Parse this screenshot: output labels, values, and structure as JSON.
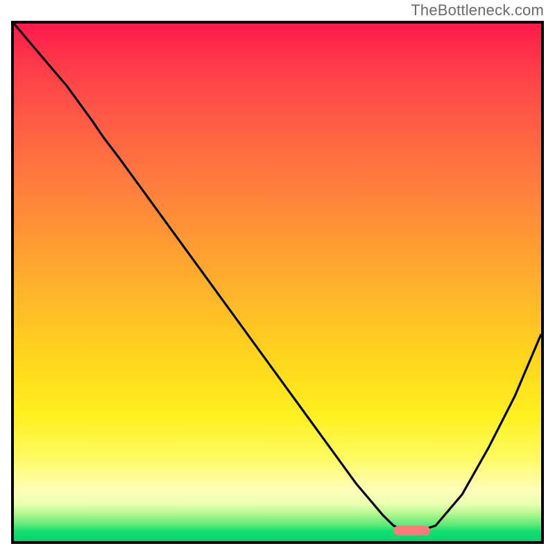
{
  "watermark": "TheBottleneck.com",
  "chart_data": {
    "type": "line",
    "title": "",
    "xlabel": "",
    "ylabel": "",
    "xlim": [
      0,
      100
    ],
    "ylim": [
      0,
      100
    ],
    "grid": false,
    "legend": false,
    "background_gradient": {
      "orientation": "vertical",
      "stops": [
        {
          "pos": 0.0,
          "color": "#ff1a4b"
        },
        {
          "pos": 0.3,
          "color": "#ff7a3e"
        },
        {
          "pos": 0.66,
          "color": "#ffd91c"
        },
        {
          "pos": 0.9,
          "color": "#fffdb8"
        },
        {
          "pos": 1.0,
          "color": "#00d66e"
        }
      ]
    },
    "series": [
      {
        "name": "bottleneck-curve",
        "x": [
          0,
          5,
          10,
          15,
          17,
          20,
          25,
          30,
          35,
          40,
          45,
          50,
          55,
          60,
          65,
          70,
          72,
          74,
          77,
          80,
          85,
          90,
          95,
          100
        ],
        "y": [
          100,
          94,
          88,
          81,
          78,
          74,
          67,
          60,
          53,
          46,
          39,
          32,
          25,
          18,
          11,
          5,
          3,
          2,
          2,
          3,
          9,
          18,
          28,
          40
        ]
      }
    ],
    "marker": {
      "name": "optimum-range",
      "shape": "pill",
      "color": "#fa7a7c",
      "x_start": 72,
      "x_end": 79,
      "y": 2
    }
  }
}
